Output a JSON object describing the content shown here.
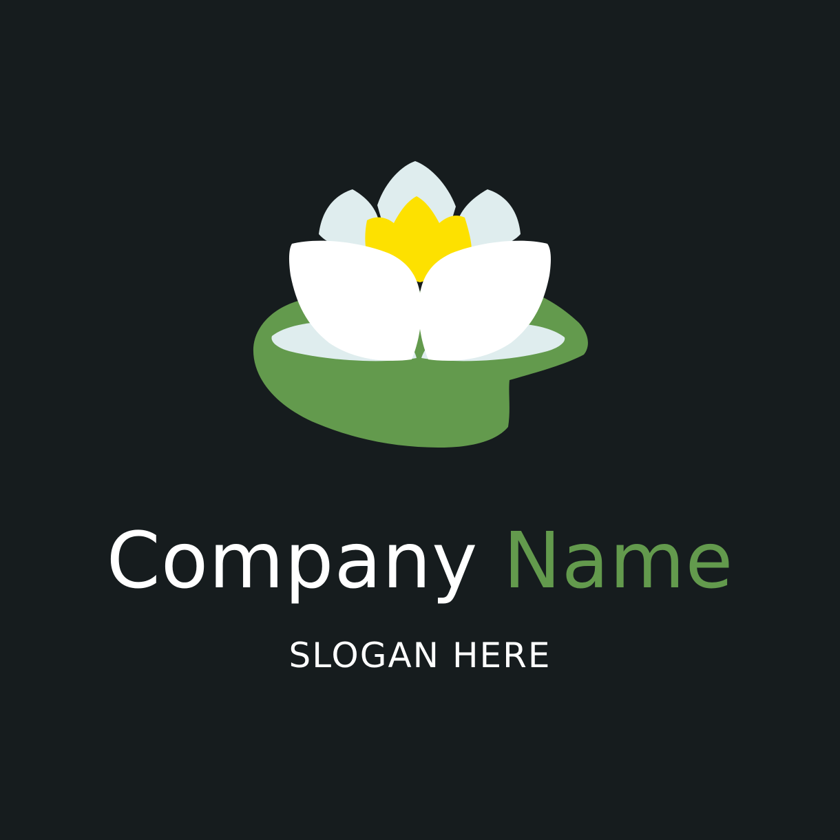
{
  "logo": {
    "icon": "water-lily-icon",
    "colors": {
      "background": "#161c1e",
      "leaf": "#639a4d",
      "petal_front": "#ffffff",
      "petal_back": "#dfedee",
      "center": "#fde100"
    }
  },
  "brand": {
    "company_word": "Company",
    "name_word": "Name",
    "slogan": "SLOGAN HERE"
  }
}
